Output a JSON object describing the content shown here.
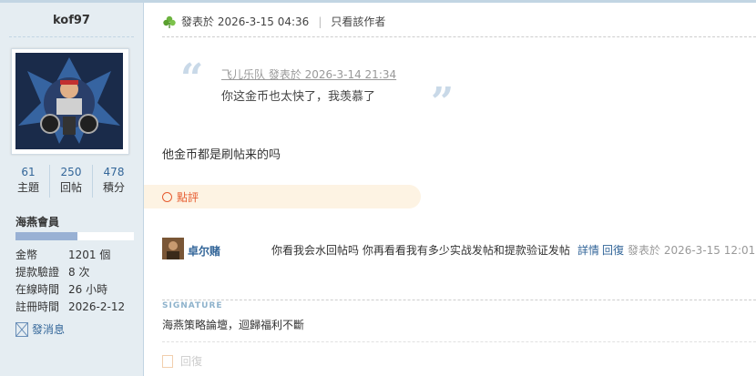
{
  "user": {
    "name": "kof97",
    "stats": [
      {
        "value": "61",
        "label": "主題"
      },
      {
        "value": "250",
        "label": "回帖"
      },
      {
        "value": "478",
        "label": "積分"
      }
    ],
    "group": "海燕會員",
    "level_progress": 0.52,
    "info": [
      {
        "key": "金幣",
        "value": "1201 個"
      },
      {
        "key": "提款驗證",
        "value": "8 次"
      },
      {
        "key": "在線時間",
        "value": "26 小時"
      },
      {
        "key": "註冊時間",
        "value": "2026-2-12"
      }
    ],
    "message_label": "發消息"
  },
  "post": {
    "header_icon": "clover-icon",
    "posted_at": "發表於 2026-3-15 04:36",
    "only_author": "只看該作者",
    "quote": {
      "author_line": "飞儿乐队 發表於 2026-3-14 21:34",
      "text": "你这金币也太快了，我羡慕了"
    },
    "content": "他金币都是刷帖来的吗",
    "rate_label": "點評"
  },
  "comment": {
    "author": "卓尔赌",
    "text": "你看我会水回帖吗 你再看看我有多少实战发帖和提款验证发帖",
    "detail_label": "詳情",
    "reply_label": "回復",
    "time": "發表於 2026-3-15 12:01"
  },
  "signature": {
    "title": "SIGNATURE",
    "text": "海燕策略論壇，迴歸福利不斷"
  },
  "reply_label": "回復",
  "colors": {
    "accent": "#336699",
    "rate": "#e65c30",
    "sidebar": "#e5edf2"
  }
}
